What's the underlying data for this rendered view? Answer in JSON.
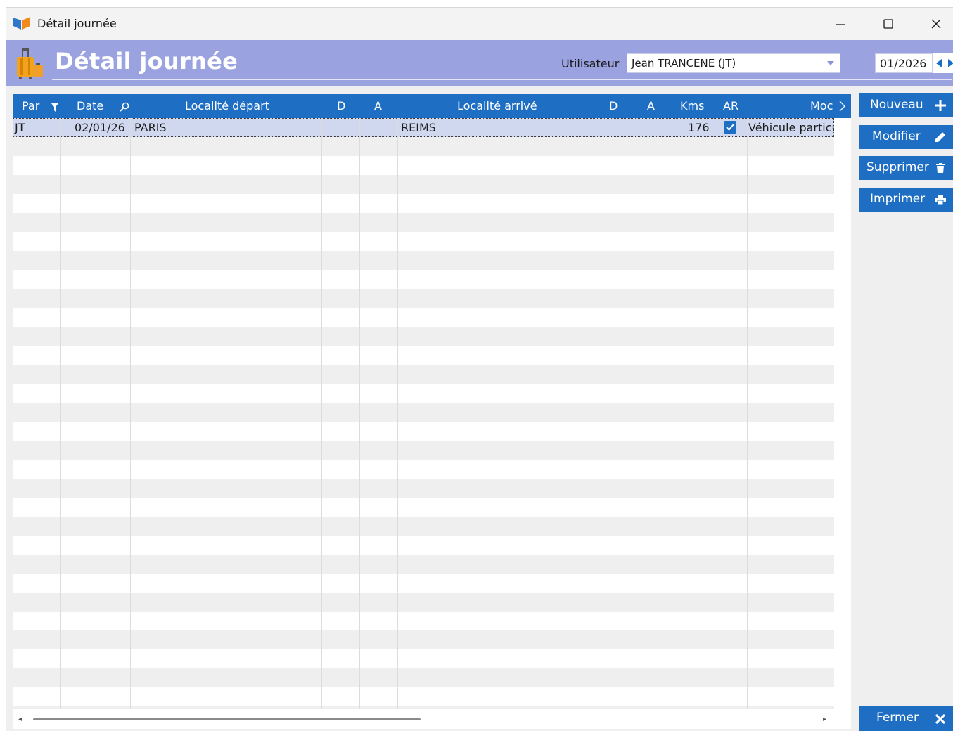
{
  "window": {
    "title": "Détail journée",
    "controls": [
      "minimize-icon",
      "maximize-icon",
      "close-icon"
    ]
  },
  "header": {
    "page_title": "Détail journée",
    "user_label": "Utilisateur",
    "user_value": "Jean TRANCENE (JT)",
    "period_value": "01/2026"
  },
  "grid": {
    "columns": [
      {
        "label": "Par",
        "icon": "filter-icon"
      },
      {
        "label": "Date",
        "icon": "search-icon"
      },
      {
        "label": "Localité départ"
      },
      {
        "label": "D"
      },
      {
        "label": "A"
      },
      {
        "label": "Localité arrivé"
      },
      {
        "label": "D"
      },
      {
        "label": "A"
      },
      {
        "label": "Kms"
      },
      {
        "label": "AR"
      },
      {
        "label": "Moc",
        "icon": "chevron-right-icon"
      }
    ],
    "rows": [
      {
        "par": "JT",
        "date": "02/01/26",
        "localite_depart": "PARIS",
        "d1": "",
        "a1": "",
        "localite_arrivee": "REIMS",
        "d2": "",
        "a2": "",
        "kms": "176",
        "ar": true,
        "mode": "Véhicule particu"
      }
    ]
  },
  "actions": {
    "new_label": "Nouveau",
    "edit_label": "Modifier",
    "delete_label": "Supprimer",
    "print_label": "Imprimer",
    "close_label": "Fermer"
  },
  "colors": {
    "accent": "#1e6fc4",
    "header_band": "#9aa2e0",
    "selected_row": "#cfd8ee",
    "alt_row": "#efefef"
  }
}
